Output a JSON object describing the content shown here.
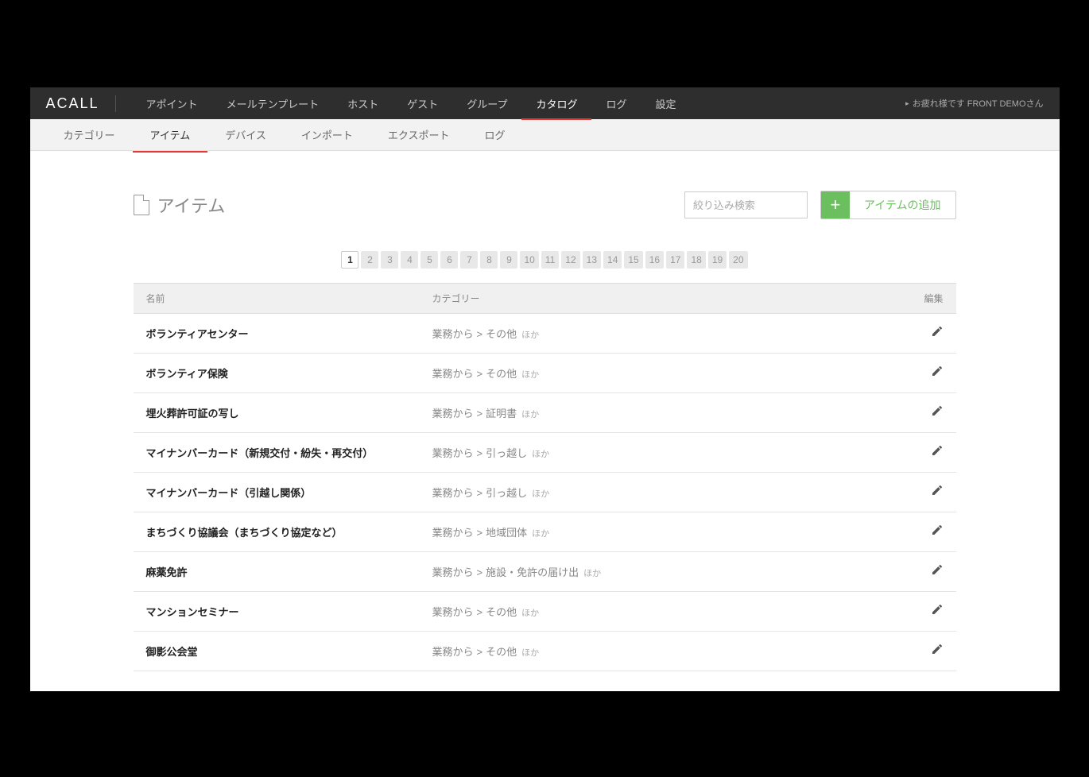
{
  "logo": "ACALL",
  "user_greeting": "お疲れ様です FRONT DEMOさん",
  "nav": {
    "items": [
      {
        "label": "アポイント",
        "active": false
      },
      {
        "label": "メールテンプレート",
        "active": false
      },
      {
        "label": "ホスト",
        "active": false
      },
      {
        "label": "ゲスト",
        "active": false
      },
      {
        "label": "グループ",
        "active": false
      },
      {
        "label": "カタログ",
        "active": true
      },
      {
        "label": "ログ",
        "active": false
      },
      {
        "label": "設定",
        "active": false
      }
    ]
  },
  "subtabs": [
    {
      "label": "カテゴリー",
      "active": false
    },
    {
      "label": "アイテム",
      "active": true
    },
    {
      "label": "デバイス",
      "active": false
    },
    {
      "label": "インポート",
      "active": false
    },
    {
      "label": "エクスポート",
      "active": false
    },
    {
      "label": "ログ",
      "active": false
    }
  ],
  "page": {
    "title": "アイテム",
    "search_placeholder": "絞り込み検索",
    "add_button": "アイテムの追加"
  },
  "pagination": {
    "pages": [
      "1",
      "2",
      "3",
      "4",
      "5",
      "6",
      "7",
      "8",
      "9",
      "10",
      "11",
      "12",
      "13",
      "14",
      "15",
      "16",
      "17",
      "18",
      "19",
      "20"
    ],
    "current": "1"
  },
  "table": {
    "headers": {
      "name": "名前",
      "category": "カテゴリー",
      "edit": "編集"
    },
    "rows": [
      {
        "name": "ボランティアセンター",
        "cat1": "業務から",
        "cat2": "その他",
        "extra": "ほか"
      },
      {
        "name": "ボランティア保険",
        "cat1": "業務から",
        "cat2": "その他",
        "extra": "ほか"
      },
      {
        "name": "埋火葬許可証の写し",
        "cat1": "業務から",
        "cat2": "証明書",
        "extra": "ほか"
      },
      {
        "name": "マイナンバーカード（新規交付・紛失・再交付）",
        "cat1": "業務から",
        "cat2": "引っ越し",
        "extra": "ほか"
      },
      {
        "name": "マイナンバーカード（引越し関係）",
        "cat1": "業務から",
        "cat2": "引っ越し",
        "extra": "ほか"
      },
      {
        "name": "まちづくり協議会（まちづくり協定など）",
        "cat1": "業務から",
        "cat2": "地域団体",
        "extra": "ほか"
      },
      {
        "name": "麻薬免許",
        "cat1": "業務から",
        "cat2": "施設・免許の届け出",
        "extra": "ほか"
      },
      {
        "name": "マンションセミナー",
        "cat1": "業務から",
        "cat2": "その他",
        "extra": "ほか"
      },
      {
        "name": "御影公会堂",
        "cat1": "業務から",
        "cat2": "その他",
        "extra": "ほか"
      }
    ]
  }
}
